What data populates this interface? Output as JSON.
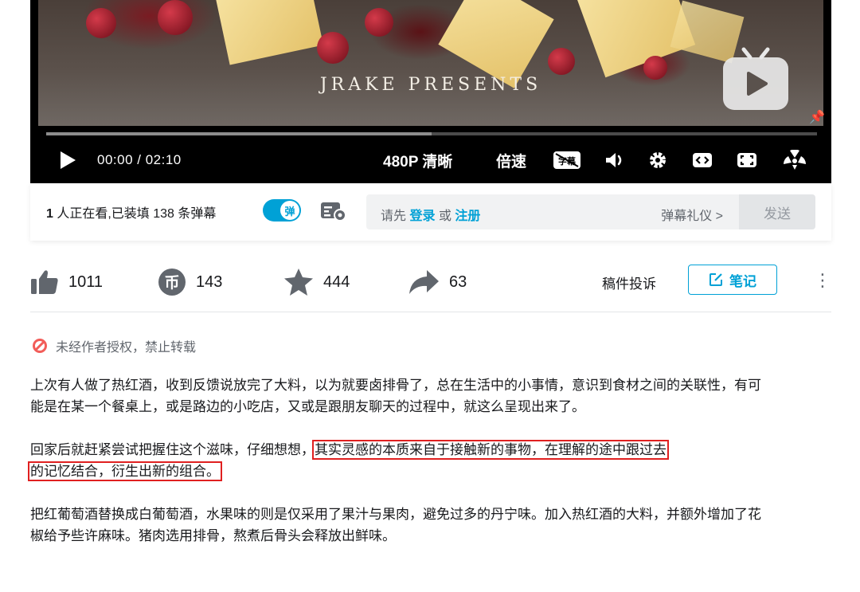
{
  "player": {
    "video_caption": "JRAKE PRESENTS",
    "time_display": "00:00 / 02:10",
    "quality_label": "480P 清晰",
    "speed_label": "倍速",
    "subtitle_icon_text": "字幕",
    "progress_buffered": 0.5,
    "icons": [
      "play-icon",
      "subtitle-icon",
      "volume-icon",
      "settings-icon",
      "widescreen-icon",
      "webfullscreen-icon",
      "fullscreen-icon",
      "danmaku-effect-icon",
      "pin-icon",
      "bilibili-tv-icon"
    ]
  },
  "danmaku": {
    "viewer_count": "1",
    "viewer_text": " 人正在看,已装填 138 条弹幕",
    "toggle_label": "弹",
    "toggle_on": true,
    "input_prefix": "请先",
    "login_link": "登录",
    "or_text": "或",
    "register_link": "注册",
    "etiquette_label": "弹幕礼仪 >",
    "send_label": "发送"
  },
  "actions": {
    "like_count": "1011",
    "coin_count": "143",
    "favorite_count": "444",
    "share_count": "63",
    "coin_glyph": "币",
    "report_label": "稿件投诉",
    "note_label": "笔记",
    "more_glyph": "⋮"
  },
  "notice": {
    "text": "未经作者授权，禁止转载"
  },
  "description": {
    "p1": "上次有人做了热红酒，收到反馈说放完了大料，以为就要卤排骨了，总在生活中的小事情，意识到食材之间的关联性，有可能是在某一个餐桌上，或是路边的小吃店，又或是跟朋友聊天的过程中，就这么呈现出来了。",
    "p2_plain": "回家后就赶紧尝试把握住这个滋味，仔细想想，",
    "p2_highlight_a": "其实灵感的本质来自于接触新的事物，在理解的途中跟过去",
    "p2_highlight_b": "的记忆结合，衍生出新的组合。",
    "p3": "把红葡萄酒替换成白葡萄酒，水果味的则是仅采用了果汁与果肉，避免过多的丹宁味。加入热红酒的大料，并额外增加了花椒给予些许麻味。猪肉选用排骨，熬煮后骨头会释放出鲜味。"
  },
  "colors": {
    "accent": "#00a1d6",
    "highlight_box": "#e02020",
    "muted_text": "#61666d"
  }
}
